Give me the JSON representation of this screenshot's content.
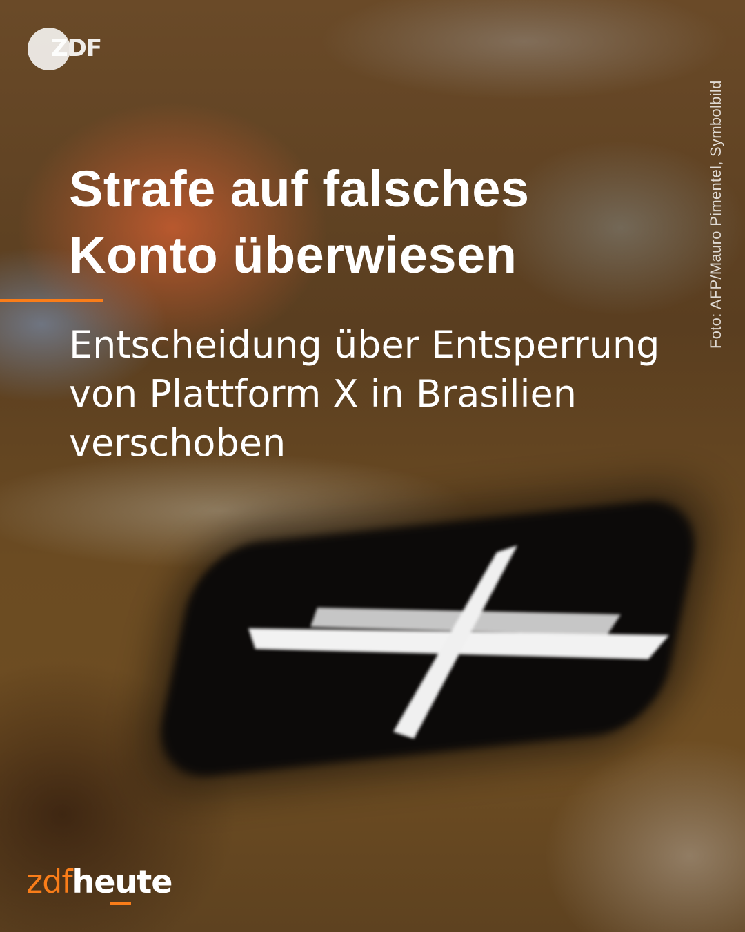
{
  "logo": {
    "top_left": "ZDF"
  },
  "headline": {
    "line1": "Strafe auf falsches",
    "line2": "Konto überwiesen"
  },
  "subline": {
    "line1": "Entscheidung über Entsperrung",
    "line2": "von Plattform X in Brasilien",
    "line3": "verschoben"
  },
  "credit": "Foto: AFP/Mauro Pimentel, Symbolbild",
  "brand": {
    "part1": "zdf",
    "part2": "heute"
  },
  "colors": {
    "accent": "#fa7d19",
    "text": "#ffffff"
  },
  "icons": {
    "photo_subject": "x-app-icon",
    "logo": "zdf-logo"
  }
}
